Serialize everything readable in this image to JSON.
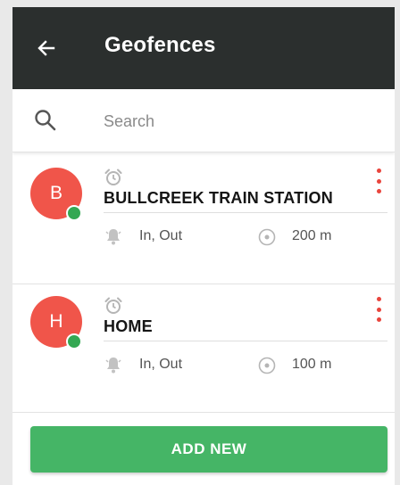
{
  "appbar": {
    "title": "Geofences",
    "back_icon": "arrow-left-icon",
    "background": "#2b2f2e"
  },
  "search": {
    "placeholder": "Search",
    "value": "",
    "icon": "search-icon"
  },
  "geofences": [
    {
      "initial": "B",
      "name": "BULLCREEK TRAIN STATION",
      "trigger": "In, Out",
      "radius": "200 m",
      "status": "active",
      "avatar_color": "#f0554a",
      "status_color": "#34a853"
    },
    {
      "initial": "H",
      "name": "HOME",
      "trigger": "In, Out",
      "radius": "100 m",
      "status": "active",
      "avatar_color": "#f0554a",
      "status_color": "#34a853"
    }
  ],
  "actions": {
    "add_label": "ADD NEW",
    "add_color": "#45b566",
    "menu_dot_color": "#e9453d"
  }
}
